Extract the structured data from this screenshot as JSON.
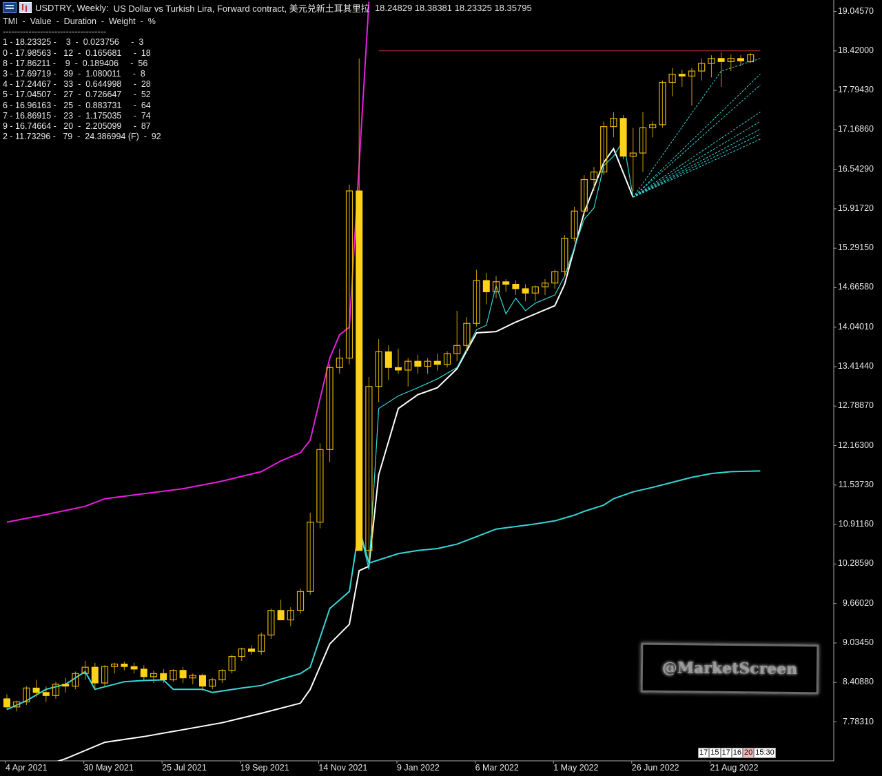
{
  "header": {
    "symbol": "USDTRY",
    "timeframe": "Weekly:",
    "description": "US Dollar vs Turkish Lira, Forward contract, 美元兑新土耳其里拉",
    "ohlc": "18.24829 18.38381 18.23325 18.35795"
  },
  "tmi_panel": {
    "title": "TMI  -  Value  -  Duration  -  Weight  -  %",
    "separator": "------------------------------------",
    "rows": [
      "1 - 18.23325 -    3  -  0.023756     -  3",
      "0 - 17.98563 -   12  -  0.165681     -  18",
      "8 - 17.86211 -    9  -  0.189406     -  56",
      "3 - 17.69719 -   39  -  1.080011     -  8",
      "4 - 17.24467 -   33  -  0.644998     -  28",
      "5 - 17.04507 -   27  -  0.726647     -  52",
      "6 - 16.96163 -   25  -  0.883731     -  64",
      "7 - 16.86915 -   23  -  1.175035     -  74",
      "9 - 16.74664 -   20  -  2.205099     -  87",
      "2 - 11.73296 -   79  -  24.386994 (F)  -  92"
    ]
  },
  "watermark": "@MarketScreen",
  "time_box": [
    "17",
    "15",
    "17",
    "16",
    "20",
    "15:30"
  ],
  "colors": {
    "bull": "#e6b400",
    "bear": "#ffd21a",
    "magenta": "#e81ee0",
    "cyan": "#36d6d6",
    "white": "#ffffff",
    "red": "#c0392b"
  },
  "chart_data": {
    "type": "candlestick",
    "ylim": [
      7.1,
      19.2
    ],
    "y_ticks": [
      "19.04570",
      "18.42000",
      "17.79430",
      "17.16860",
      "16.54290",
      "15.91720",
      "15.29150",
      "14.66580",
      "14.04010",
      "13.41440",
      "12.78870",
      "12.16300",
      "11.53730",
      "10.91160",
      "10.28590",
      "9.66020",
      "9.03450",
      "8.40880",
      "7.78310"
    ],
    "x_ticks": [
      "4 Apr 2021",
      "30 May 2021",
      "25 Jul 2021",
      "19 Sep 2021",
      "14 Nov 2021",
      "9 Jan 2022",
      "6 Mar 2022",
      "1 May 2022",
      "26 Jun 2022",
      "21 Aug 2022"
    ],
    "x_tick_weeks": [
      0,
      8,
      16,
      24,
      32,
      40,
      48,
      56,
      64,
      72
    ],
    "candles": [
      [
        8.15,
        8.22,
        7.98,
        8.02
      ],
      [
        8.02,
        8.12,
        7.95,
        8.1
      ],
      [
        8.1,
        8.35,
        8.05,
        8.32
      ],
      [
        8.32,
        8.45,
        8.18,
        8.25
      ],
      [
        8.25,
        8.35,
        8.1,
        8.2
      ],
      [
        8.2,
        8.42,
        8.15,
        8.38
      ],
      [
        8.38,
        8.48,
        8.25,
        8.35
      ],
      [
        8.35,
        8.58,
        8.3,
        8.55
      ],
      [
        8.55,
        8.75,
        8.45,
        8.65
      ],
      [
        8.65,
        8.72,
        8.3,
        8.4
      ],
      [
        8.4,
        8.68,
        8.35,
        8.66
      ],
      [
        8.66,
        8.72,
        8.55,
        8.7
      ],
      [
        8.7,
        8.74,
        8.6,
        8.66
      ],
      [
        8.66,
        8.72,
        8.55,
        8.62
      ],
      [
        8.62,
        8.68,
        8.45,
        8.5
      ],
      [
        8.5,
        8.6,
        8.4,
        8.55
      ],
      [
        8.55,
        8.62,
        8.4,
        8.45
      ],
      [
        8.45,
        8.62,
        8.42,
        8.6
      ],
      [
        8.6,
        8.65,
        8.4,
        8.48
      ],
      [
        8.48,
        8.55,
        8.38,
        8.52
      ],
      [
        8.52,
        8.55,
        8.28,
        8.35
      ],
      [
        8.35,
        8.48,
        8.3,
        8.45
      ],
      [
        8.45,
        8.62,
        8.4,
        8.6
      ],
      [
        8.6,
        8.85,
        8.55,
        8.82
      ],
      [
        8.82,
        8.96,
        8.75,
        8.94
      ],
      [
        8.94,
        9.0,
        8.85,
        8.9
      ],
      [
        8.9,
        9.2,
        8.85,
        9.16
      ],
      [
        9.16,
        9.58,
        9.1,
        9.55
      ],
      [
        9.55,
        9.72,
        9.4,
        9.4
      ],
      [
        9.4,
        9.6,
        9.3,
        9.55
      ],
      [
        9.55,
        9.9,
        9.5,
        9.85
      ],
      [
        9.85,
        11.1,
        9.8,
        10.95
      ],
      [
        10.95,
        12.2,
        10.85,
        12.1
      ],
      [
        12.1,
        13.45,
        11.9,
        13.4
      ],
      [
        13.4,
        13.7,
        13.3,
        13.55
      ],
      [
        13.55,
        16.3,
        13.45,
        16.2
      ],
      [
        16.2,
        18.3,
        13.8,
        10.5
      ],
      [
        10.5,
        13.25,
        10.35,
        13.1
      ],
      [
        13.1,
        13.85,
        12.85,
        13.65
      ],
      [
        13.65,
        13.75,
        13.2,
        13.4
      ],
      [
        13.4,
        13.7,
        13.3,
        13.36
      ],
      [
        13.36,
        13.55,
        13.1,
        13.5
      ],
      [
        13.5,
        13.6,
        13.3,
        13.42
      ],
      [
        13.42,
        13.55,
        13.3,
        13.5
      ],
      [
        13.5,
        13.62,
        13.35,
        13.45
      ],
      [
        13.45,
        13.66,
        13.4,
        13.62
      ],
      [
        13.62,
        14.3,
        13.5,
        13.75
      ],
      [
        13.75,
        14.2,
        13.65,
        14.1
      ],
      [
        14.1,
        14.95,
        14.05,
        14.78
      ],
      [
        14.78,
        14.9,
        14.4,
        14.6
      ],
      [
        14.6,
        14.85,
        14.5,
        14.76
      ],
      [
        14.76,
        14.8,
        14.6,
        14.72
      ],
      [
        14.72,
        14.78,
        14.55,
        14.65
      ],
      [
        14.65,
        14.72,
        14.45,
        14.58
      ],
      [
        14.58,
        14.7,
        14.45,
        14.68
      ],
      [
        14.68,
        14.8,
        14.55,
        14.74
      ],
      [
        14.74,
        14.95,
        14.65,
        14.92
      ],
      [
        14.92,
        15.5,
        14.85,
        15.45
      ],
      [
        15.45,
        15.95,
        15.4,
        15.88
      ],
      [
        15.88,
        16.45,
        15.8,
        16.38
      ],
      [
        16.38,
        16.58,
        16.2,
        16.5
      ],
      [
        16.5,
        17.3,
        16.45,
        17.22
      ],
      [
        17.22,
        17.45,
        17.05,
        17.35
      ],
      [
        17.35,
        17.4,
        16.7,
        16.75
      ],
      [
        16.75,
        17.2,
        16.2,
        16.8
      ],
      [
        16.8,
        17.45,
        16.5,
        17.2
      ],
      [
        17.2,
        17.3,
        17.05,
        17.25
      ],
      [
        17.25,
        17.95,
        17.2,
        17.92
      ],
      [
        17.92,
        18.15,
        17.7,
        18.05
      ],
      [
        18.05,
        18.12,
        17.85,
        18.02
      ],
      [
        18.02,
        18.15,
        17.55,
        18.1
      ],
      [
        18.1,
        18.3,
        17.95,
        18.22
      ],
      [
        18.22,
        18.35,
        18.0,
        18.3
      ],
      [
        18.3,
        18.4,
        17.85,
        18.25
      ],
      [
        18.25,
        18.36,
        18.1,
        18.3
      ],
      [
        18.3,
        18.35,
        18.18,
        18.26
      ],
      [
        18.24829,
        18.38381,
        18.23325,
        18.35795
      ]
    ],
    "red_line_level": 18.42,
    "red_line_range": [
      38,
      77
    ],
    "magenta_line": [
      [
        0,
        10.95
      ],
      [
        4,
        11.07
      ],
      [
        8,
        11.2
      ],
      [
        10,
        11.32
      ],
      [
        14,
        11.4
      ],
      [
        18,
        11.48
      ],
      [
        22,
        11.6
      ],
      [
        26,
        11.75
      ],
      [
        28,
        11.92
      ],
      [
        30,
        12.05
      ],
      [
        31,
        12.25
      ],
      [
        33,
        13.55
      ],
      [
        34,
        13.92
      ],
      [
        35,
        14.04
      ],
      [
        37,
        19.2
      ]
    ],
    "white_line": [
      [
        4,
        7.1
      ],
      [
        6,
        7.2
      ],
      [
        8,
        7.33
      ],
      [
        10,
        7.46
      ],
      [
        14,
        7.55
      ],
      [
        18,
        7.66
      ],
      [
        22,
        7.77
      ],
      [
        26,
        7.92
      ],
      [
        30,
        8.08
      ],
      [
        31,
        8.3
      ],
      [
        33,
        9.02
      ],
      [
        35,
        9.33
      ],
      [
        36,
        10.18
      ],
      [
        37,
        10.25
      ],
      [
        38,
        11.7
      ],
      [
        40,
        12.75
      ],
      [
        42,
        12.97
      ],
      [
        44,
        13.08
      ],
      [
        46,
        13.38
      ],
      [
        48,
        13.95
      ],
      [
        50,
        13.97
      ],
      [
        52,
        14.12
      ],
      [
        54,
        14.25
      ],
      [
        56,
        14.38
      ],
      [
        57,
        14.72
      ],
      [
        59,
        15.86
      ],
      [
        61,
        16.65
      ],
      [
        62,
        16.87
      ],
      [
        64,
        16.1
      ]
    ],
    "cyan_line": [
      [
        0,
        7.98
      ],
      [
        2,
        8.12
      ],
      [
        4,
        8.3
      ],
      [
        6,
        8.38
      ],
      [
        8,
        8.58
      ],
      [
        9,
        8.3
      ],
      [
        12,
        8.42
      ],
      [
        14,
        8.44
      ],
      [
        16,
        8.45
      ],
      [
        17,
        8.3
      ],
      [
        20,
        8.3
      ],
      [
        21,
        8.25
      ],
      [
        24,
        8.32
      ],
      [
        26,
        8.36
      ],
      [
        28,
        8.46
      ],
      [
        30,
        8.55
      ],
      [
        31,
        8.65
      ],
      [
        33,
        9.58
      ],
      [
        35,
        9.85
      ],
      [
        36,
        10.85
      ],
      [
        37,
        10.3
      ],
      [
        40,
        10.45
      ],
      [
        42,
        10.5
      ],
      [
        44,
        10.53
      ],
      [
        46,
        10.6
      ],
      [
        48,
        10.72
      ],
      [
        50,
        10.84
      ],
      [
        52,
        10.88
      ],
      [
        54,
        10.92
      ],
      [
        56,
        10.97
      ],
      [
        58,
        11.06
      ],
      [
        59,
        11.12
      ],
      [
        61,
        11.22
      ],
      [
        62,
        11.32
      ],
      [
        64,
        11.43
      ],
      [
        66,
        11.5
      ],
      [
        68,
        11.58
      ],
      [
        70,
        11.66
      ],
      [
        72,
        11.72
      ],
      [
        74,
        11.75
      ],
      [
        77,
        11.76
      ]
    ],
    "cyan_main": [
      [
        36,
        10.85
      ],
      [
        37,
        10.2
      ],
      [
        38,
        12.75
      ],
      [
        40,
        12.95
      ],
      [
        42,
        13.08
      ],
      [
        44,
        13.22
      ],
      [
        46,
        13.4
      ],
      [
        48,
        14.0
      ],
      [
        49,
        14.07
      ],
      [
        50,
        14.7
      ],
      [
        51,
        14.25
      ],
      [
        52,
        14.5
      ],
      [
        53,
        14.3
      ],
      [
        54,
        14.42
      ],
      [
        56,
        14.55
      ],
      [
        57,
        14.85
      ],
      [
        59,
        15.75
      ],
      [
        60,
        15.93
      ],
      [
        61,
        16.6
      ],
      [
        62,
        16.75
      ],
      [
        63,
        17.0
      ],
      [
        64,
        16.1
      ]
    ],
    "fans": [
      [
        [
          64,
          16.1
        ],
        [
          77,
          18.05
        ]
      ],
      [
        [
          64,
          16.1
        ],
        [
          77,
          17.88
        ]
      ],
      [
        [
          64,
          16.1
        ],
        [
          77,
          17.45
        ]
      ],
      [
        [
          64,
          16.1
        ],
        [
          77,
          17.3
        ]
      ],
      [
        [
          64,
          16.1
        ],
        [
          77,
          17.18
        ]
      ],
      [
        [
          64,
          16.1
        ],
        [
          77,
          17.1
        ]
      ],
      [
        [
          64,
          16.1
        ],
        [
          77,
          17.02
        ]
      ],
      [
        [
          64,
          16.1
        ],
        [
          73,
          18.1
        ],
        [
          77,
          18.3
        ]
      ]
    ]
  }
}
